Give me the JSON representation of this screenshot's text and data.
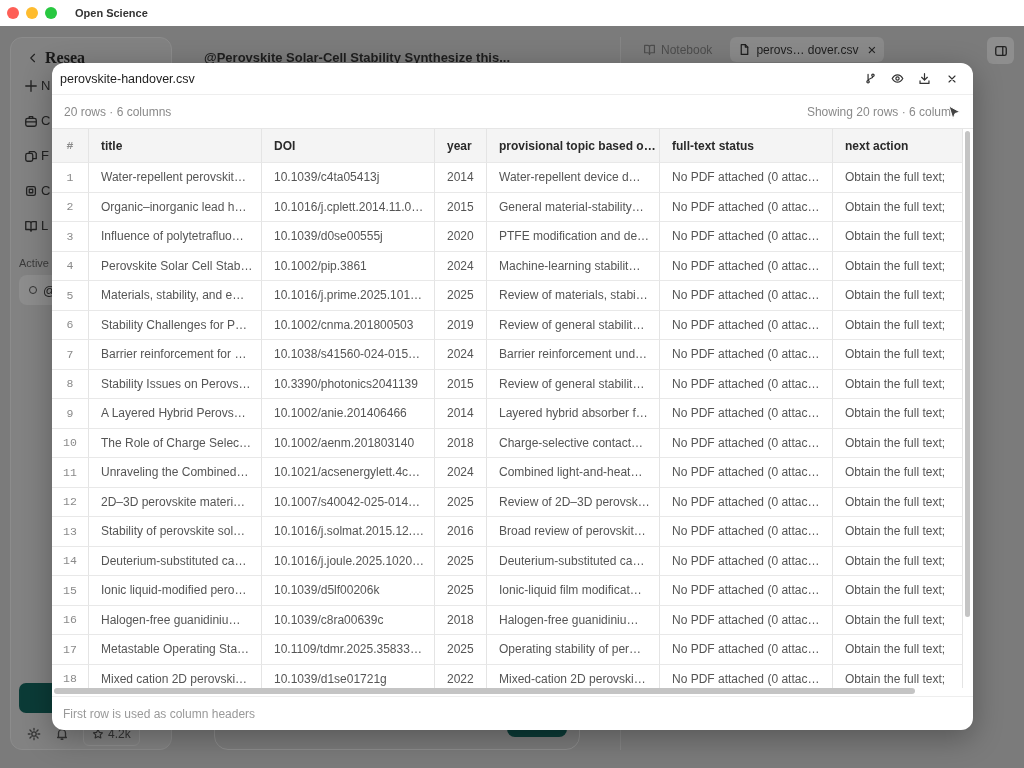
{
  "window": {
    "title": "Open Science"
  },
  "sidebar": {
    "title": "Resea",
    "items": [
      {
        "label": "N",
        "kind": "new"
      },
      {
        "label": "C",
        "kind": "briefcase"
      },
      {
        "label": "F",
        "kind": "files"
      },
      {
        "label": "C",
        "kind": "chip"
      },
      {
        "label": "L",
        "kind": "book"
      }
    ],
    "section": "Active",
    "active_item": "@",
    "repo_badge": "4.2k"
  },
  "conversation": {
    "title": "@Perovskite Solar-Cell Stability Synthesize this..."
  },
  "tabs": [
    {
      "label": "Notebook",
      "kind": "notebook",
      "selected": false
    },
    {
      "label": "perovs… dover.csv",
      "kind": "file",
      "selected": true,
      "close": "×"
    }
  ],
  "dialog": {
    "title": "perovskite-handover.csv",
    "summary": "20 rows · 6 columns",
    "showing": "Showing 20 rows · 6 colum",
    "columns": [
      "#",
      "title",
      "DOI",
      "year",
      "provisional topic based o…",
      "full-text status",
      "next action"
    ],
    "rows": [
      [
        "1",
        "Water-repellent perovskit…",
        "10.1039/c4ta05413j",
        "2014",
        "Water-repellent device d…",
        "No PDF attached (0 attac…",
        "Obtain the full text;"
      ],
      [
        "2",
        "Organic–inorganic lead h…",
        "10.1016/j.cplett.2014.11.0…",
        "2015",
        "General material-stability…",
        "No PDF attached (0 attac…",
        "Obtain the full text;"
      ],
      [
        "3",
        "Influence of polytetrafluo…",
        "10.1039/d0se00555j",
        "2020",
        "PTFE modification and de…",
        "No PDF attached (0 attac…",
        "Obtain the full text;"
      ],
      [
        "4",
        "Perovskite Solar Cell Stab…",
        "10.1002/pip.3861",
        "2024",
        "Machine-learning stabilit…",
        "No PDF attached (0 attac…",
        "Obtain the full text;"
      ],
      [
        "5",
        "Materials, stability, and e…",
        "10.1016/j.prime.2025.101…",
        "2025",
        "Review of materials, stabi…",
        "No PDF attached (0 attac…",
        "Obtain the full text;"
      ],
      [
        "6",
        "Stability Challenges for P…",
        "10.1002/cnma.201800503",
        "2019",
        "Review of general stabilit…",
        "No PDF attached (0 attac…",
        "Obtain the full text;"
      ],
      [
        "7",
        "Barrier reinforcement for …",
        "10.1038/s41560-024-015…",
        "2024",
        "Barrier reinforcement und…",
        "No PDF attached (0 attac…",
        "Obtain the full text;"
      ],
      [
        "8",
        "Stability Issues on Perovs…",
        "10.3390/photonics2041139",
        "2015",
        "Review of general stabilit…",
        "No PDF attached (0 attac…",
        "Obtain the full text;"
      ],
      [
        "9",
        "A Layered Hybrid Perovs…",
        "10.1002/anie.201406466",
        "2014",
        "Layered hybrid absorber f…",
        "No PDF attached (0 attac…",
        "Obtain the full text;"
      ],
      [
        "10",
        "The Role of Charge Selec…",
        "10.1002/aenm.201803140",
        "2018",
        "Charge-selective contact…",
        "No PDF attached (0 attac…",
        "Obtain the full text;"
      ],
      [
        "11",
        "Unraveling the Combined…",
        "10.1021/acsenergylett.4c…",
        "2024",
        "Combined light-and-heat…",
        "No PDF attached (0 attac…",
        "Obtain the full text;"
      ],
      [
        "12",
        "2D–3D perovskite materi…",
        "10.1007/s40042-025-014…",
        "2025",
        "Review of 2D–3D perovsk…",
        "No PDF attached (0 attac…",
        "Obtain the full text;"
      ],
      [
        "13",
        "Stability of perovskite sol…",
        "10.1016/j.solmat.2015.12.…",
        "2016",
        "Broad review of perovskit…",
        "No PDF attached (0 attac…",
        "Obtain the full text;"
      ],
      [
        "14",
        "Deuterium-substituted ca…",
        "10.1016/j.joule.2025.1020…",
        "2025",
        "Deuterium-substituted ca…",
        "No PDF attached (0 attac…",
        "Obtain the full text;"
      ],
      [
        "15",
        "Ionic liquid-modified pero…",
        "10.1039/d5lf00206k",
        "2025",
        "Ionic-liquid film modificat…",
        "No PDF attached (0 attac…",
        "Obtain the full text;"
      ],
      [
        "16",
        "Halogen-free guanidiniu…",
        "10.1039/c8ra00639c",
        "2018",
        "Halogen-free guanidiniu…",
        "No PDF attached (0 attac…",
        "Obtain the full text;"
      ],
      [
        "17",
        "Metastable Operating Sta…",
        "10.1109/tdmr.2025.35833…",
        "2025",
        "Operating stability of per…",
        "No PDF attached (0 attac…",
        "Obtain the full text;"
      ],
      [
        "18",
        "Mixed cation 2D perovski…",
        "10.1039/d1se01721g",
        "2022",
        "Mixed-cation 2D perovski…",
        "No PDF attached (0 attac…",
        "Obtain the full text;"
      ]
    ],
    "footer": "First row is used as column headers"
  }
}
